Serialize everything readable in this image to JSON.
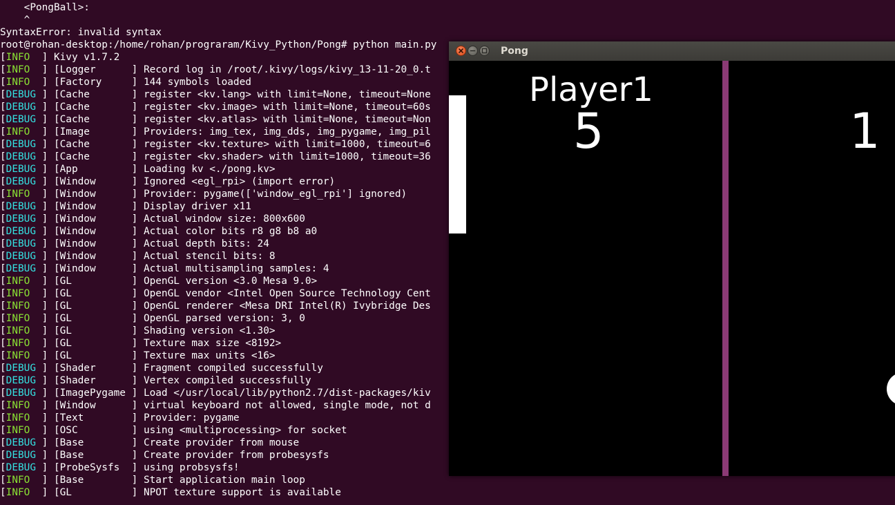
{
  "terminal": {
    "pre_lines": [
      "    <PongBall>:",
      "    ^",
      "SyntaxError: invalid syntax",
      "root@rohan-desktop:/home/rohan/prograram/Kivy_Python/Pong# python main.py"
    ],
    "log": [
      {
        "level": "INFO",
        "module": "Kivy v1.7.2",
        "message": ""
      },
      {
        "level": "INFO",
        "module": "[Logger      ]",
        "message": "Record log in /root/.kivy/logs/kivy_13-11-20_0.t"
      },
      {
        "level": "INFO",
        "module": "[Factory     ]",
        "message": "144 symbols loaded"
      },
      {
        "level": "DEBUG",
        "module": "[Cache       ]",
        "message": "register <kv.lang> with limit=None, timeout=None"
      },
      {
        "level": "DEBUG",
        "module": "[Cache       ]",
        "message": "register <kv.image> with limit=None, timeout=60s"
      },
      {
        "level": "DEBUG",
        "module": "[Cache       ]",
        "message": "register <kv.atlas> with limit=None, timeout=Non"
      },
      {
        "level": "INFO",
        "module": "[Image       ]",
        "message": "Providers: img_tex, img_dds, img_pygame, img_pil"
      },
      {
        "level": "DEBUG",
        "module": "[Cache       ]",
        "message": "register <kv.texture> with limit=1000, timeout=6"
      },
      {
        "level": "DEBUG",
        "module": "[Cache       ]",
        "message": "register <kv.shader> with limit=1000, timeout=36"
      },
      {
        "level": "DEBUG",
        "module": "[App         ]",
        "message": "Loading kv <./pong.kv>"
      },
      {
        "level": "DEBUG",
        "module": "[Window      ]",
        "message": "Ignored <egl_rpi> (import error)"
      },
      {
        "level": "INFO",
        "module": "[Window      ]",
        "message": "Provider: pygame(['window_egl_rpi'] ignored)"
      },
      {
        "level": "DEBUG",
        "module": "[Window      ]",
        "message": "Display driver x11"
      },
      {
        "level": "DEBUG",
        "module": "[Window      ]",
        "message": "Actual window size: 800x600"
      },
      {
        "level": "DEBUG",
        "module": "[Window      ]",
        "message": "Actual color bits r8 g8 b8 a0"
      },
      {
        "level": "DEBUG",
        "module": "[Window      ]",
        "message": "Actual depth bits: 24"
      },
      {
        "level": "DEBUG",
        "module": "[Window      ]",
        "message": "Actual stencil bits: 8"
      },
      {
        "level": "DEBUG",
        "module": "[Window      ]",
        "message": "Actual multisampling samples: 4"
      },
      {
        "level": "INFO",
        "module": "[GL          ]",
        "message": "OpenGL version <3.0 Mesa 9.0>"
      },
      {
        "level": "INFO",
        "module": "[GL          ]",
        "message": "OpenGL vendor <Intel Open Source Technology Cent"
      },
      {
        "level": "INFO",
        "module": "[GL          ]",
        "message": "OpenGL renderer <Mesa DRI Intel(R) Ivybridge Des"
      },
      {
        "level": "INFO",
        "module": "[GL          ]",
        "message": "OpenGL parsed version: 3, 0"
      },
      {
        "level": "INFO",
        "module": "[GL          ]",
        "message": "Shading version <1.30>"
      },
      {
        "level": "INFO",
        "module": "[GL          ]",
        "message": "Texture max size <8192>"
      },
      {
        "level": "INFO",
        "module": "[GL          ]",
        "message": "Texture max units <16>"
      },
      {
        "level": "DEBUG",
        "module": "[Shader      ]",
        "message": "Fragment compiled successfully"
      },
      {
        "level": "DEBUG",
        "module": "[Shader      ]",
        "message": "Vertex compiled successfully"
      },
      {
        "level": "DEBUG",
        "module": "[ImagePygame ]",
        "message": "Load </usr/local/lib/python2.7/dist-packages/kiv"
      },
      {
        "level": "INFO",
        "module": "[Window      ]",
        "message": "virtual keyboard not allowed, single mode, not d"
      },
      {
        "level": "INFO",
        "module": "[Text        ]",
        "message": "Provider: pygame"
      },
      {
        "level": "INFO",
        "module": "[OSC         ]",
        "message": "using <multiprocessing> for socket"
      },
      {
        "level": "DEBUG",
        "module": "[Base        ]",
        "message": "Create provider from mouse"
      },
      {
        "level": "DEBUG",
        "module": "[Base        ]",
        "message": "Create provider from probesysfs"
      },
      {
        "level": "DEBUG",
        "module": "[ProbeSysfs  ]",
        "message": "using probsysfs!"
      },
      {
        "level": "INFO",
        "module": "[Base        ]",
        "message": "Start application main loop"
      },
      {
        "level": "INFO",
        "module": "[GL          ]",
        "message": "NPOT texture support is available"
      }
    ],
    "colors": {
      "background": "#300a24",
      "info": "#8ae234",
      "debug": "#34e2e2",
      "text": "#ffffff"
    }
  },
  "window": {
    "title": "Pong",
    "buttons": {
      "close": "close-icon",
      "minimize": "minimize-icon",
      "maximize": "maximize-icon"
    }
  },
  "game": {
    "player1_label": "Player1",
    "player1_score": "5",
    "player2_score": "1",
    "colors": {
      "net": "#8b3a75",
      "paddle": "#ffffff",
      "ball": "#ffffff"
    }
  }
}
